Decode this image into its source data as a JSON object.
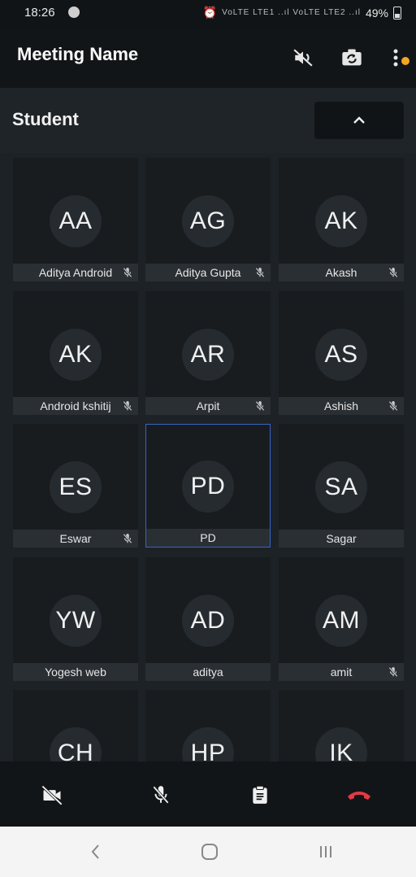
{
  "status_bar": {
    "time": "18:26",
    "battery": "49%",
    "signal_text": "VoLTE LTE1 ..ıl VoLTE LTE2 ..ıl"
  },
  "app_bar": {
    "title": "Meeting Name"
  },
  "section": {
    "title": "Student"
  },
  "participants": [
    {
      "initials": "AA",
      "name": "Aditya Android",
      "muted": true
    },
    {
      "initials": "AG",
      "name": "Aditya Gupta",
      "muted": true
    },
    {
      "initials": "AK",
      "name": "Akash",
      "muted": true
    },
    {
      "initials": "AK",
      "name": "Android kshitij",
      "muted": true
    },
    {
      "initials": "AR",
      "name": "Arpit",
      "muted": true
    },
    {
      "initials": "AS",
      "name": "Ashish",
      "muted": true
    },
    {
      "initials": "ES",
      "name": "Eswar",
      "muted": true
    },
    {
      "initials": "PD",
      "name": "PD",
      "muted": false,
      "active": true
    },
    {
      "initials": "SA",
      "name": "Sagar",
      "muted": false
    },
    {
      "initials": "YW",
      "name": "Yogesh web",
      "muted": false
    },
    {
      "initials": "AD",
      "name": "aditya",
      "muted": false
    },
    {
      "initials": "AM",
      "name": "amit",
      "muted": true
    },
    {
      "initials": "CH",
      "name": "",
      "muted": false
    },
    {
      "initials": "HP",
      "name": "",
      "muted": false
    },
    {
      "initials": "IK",
      "name": "",
      "muted": false
    }
  ],
  "icons": {
    "speaker": "speaker-off-icon",
    "camera_switch": "camera-switch-icon",
    "more": "more-vertical-icon",
    "collapse": "chevron-up-icon",
    "video": "video-off-icon",
    "mic": "mic-off-icon",
    "notes": "clipboard-icon",
    "hangup": "end-call-icon"
  },
  "colors": {
    "accent": "#3a63c8",
    "hangup": "#e53946",
    "notification": "#f5a623"
  }
}
